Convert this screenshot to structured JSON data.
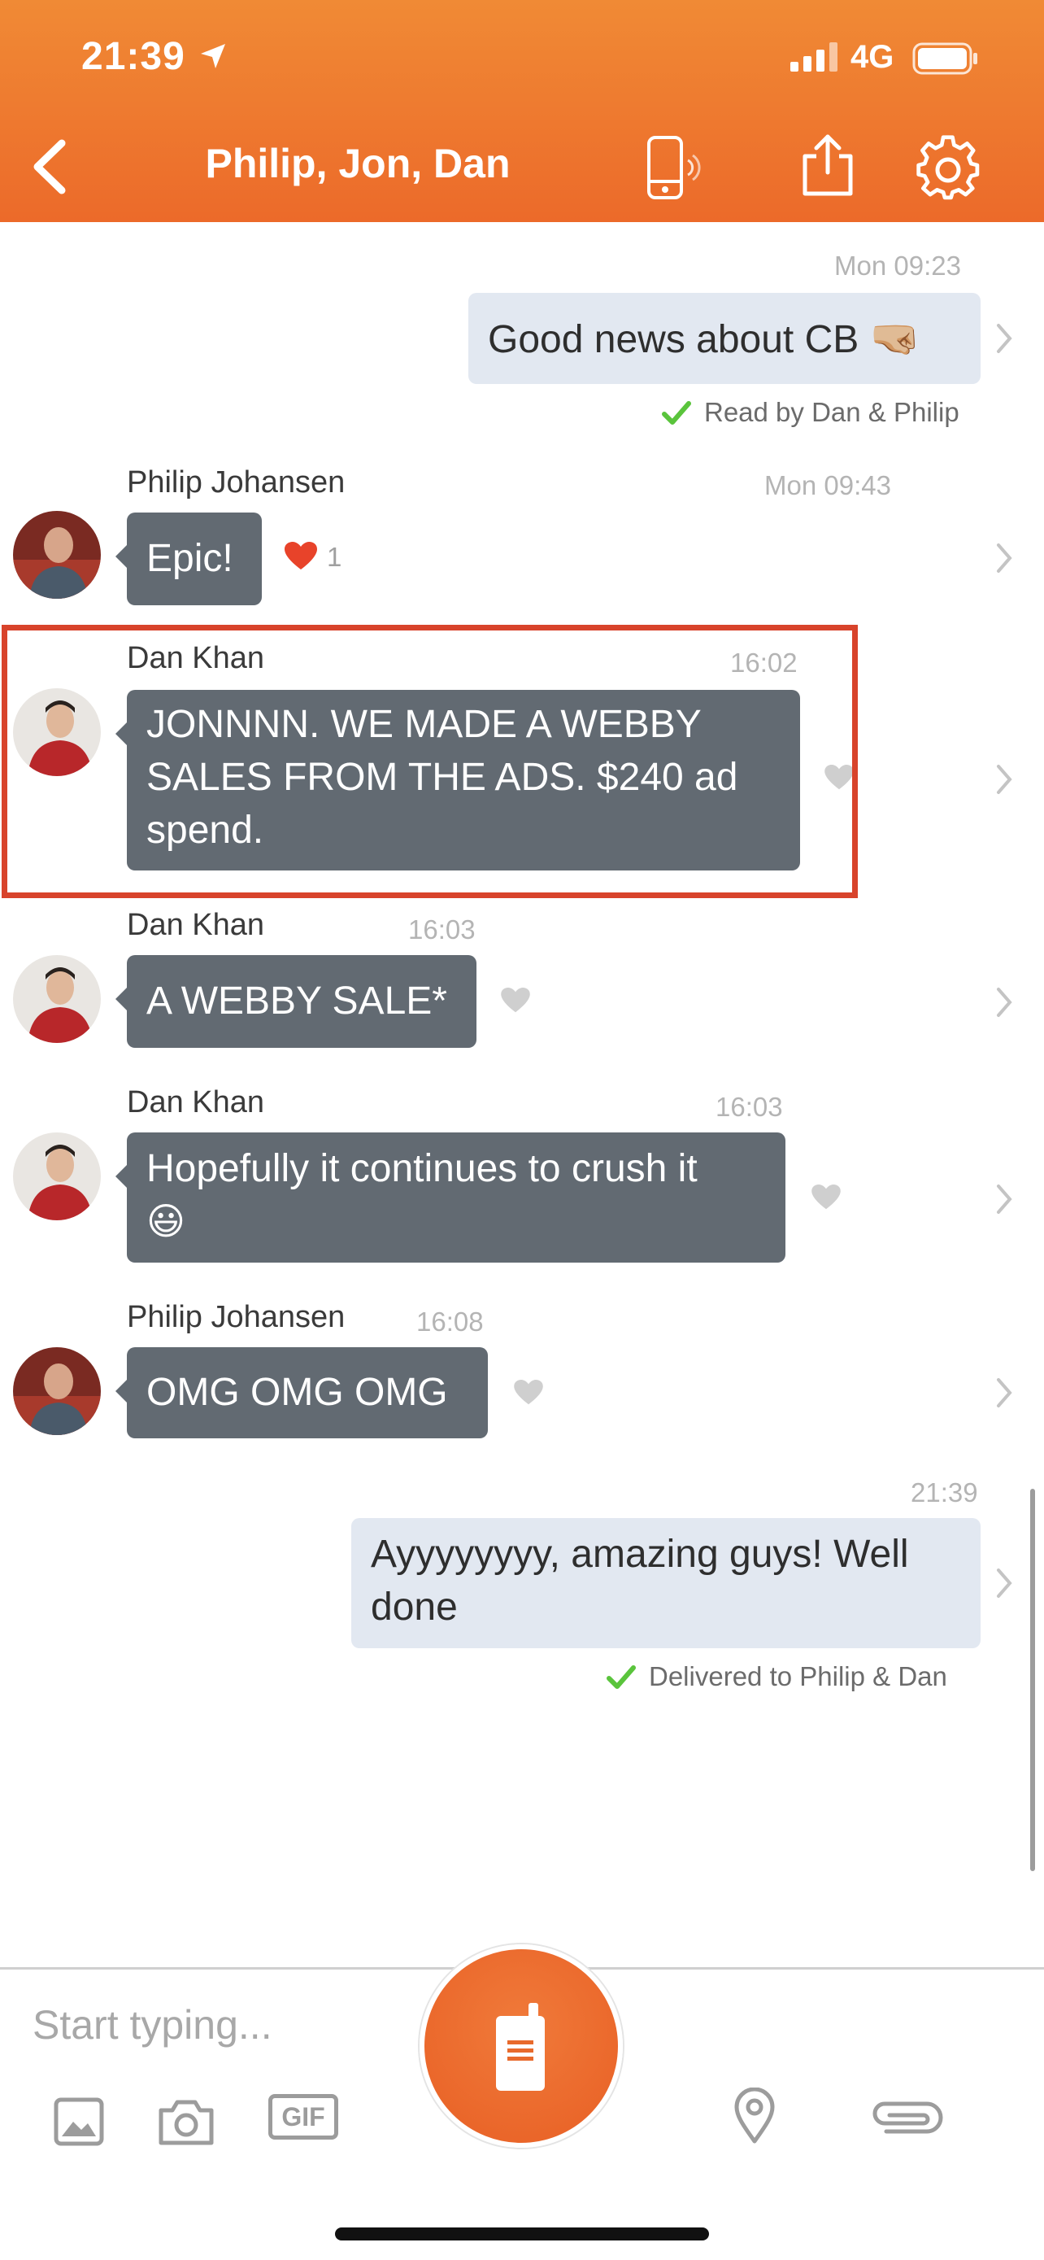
{
  "status_bar": {
    "time": "21:39",
    "network": "4G"
  },
  "header": {
    "title": "Philip, Jon, Dan"
  },
  "messages": [
    {
      "direction": "out",
      "time": "Mon 09:23",
      "text": "Good news about CB",
      "emoji": "🤜🏼",
      "receipt": "Read by Dan & Philip"
    },
    {
      "direction": "in",
      "sender": "Philip Johansen",
      "time": "Mon 09:43",
      "text": "Epic!",
      "heart_count": "1"
    },
    {
      "direction": "in",
      "sender": "Dan Khan",
      "time": "16:02",
      "lines": [
        "JONNNN. WE MADE A WEBBY",
        "SALES FROM THE ADS. $240 ad",
        "spend."
      ]
    },
    {
      "direction": "in",
      "sender": "Dan Khan",
      "time": "16:03",
      "text": "A WEBBY SALE*"
    },
    {
      "direction": "in",
      "sender": "Dan Khan",
      "time": "16:03",
      "line1": "Hopefully it continues to crush it",
      "emoji": "😃"
    },
    {
      "direction": "in",
      "sender": "Philip Johansen",
      "time": "16:08",
      "text": "OMG OMG OMG"
    },
    {
      "direction": "out",
      "time": "21:39",
      "lines": [
        "Ayyyyyyyy, amazing guys! Well",
        "done"
      ],
      "receipt": "Delivered to Philip & Dan"
    }
  ],
  "composer": {
    "placeholder": "Start typing...",
    "gif_label": "GIF"
  },
  "colors": {
    "header": "#ee7a30",
    "incoming_bubble": "#626a72",
    "outgoing_bubble": "#e2e8f1",
    "highlight": "#d8432b",
    "check": "#5ac43c"
  }
}
